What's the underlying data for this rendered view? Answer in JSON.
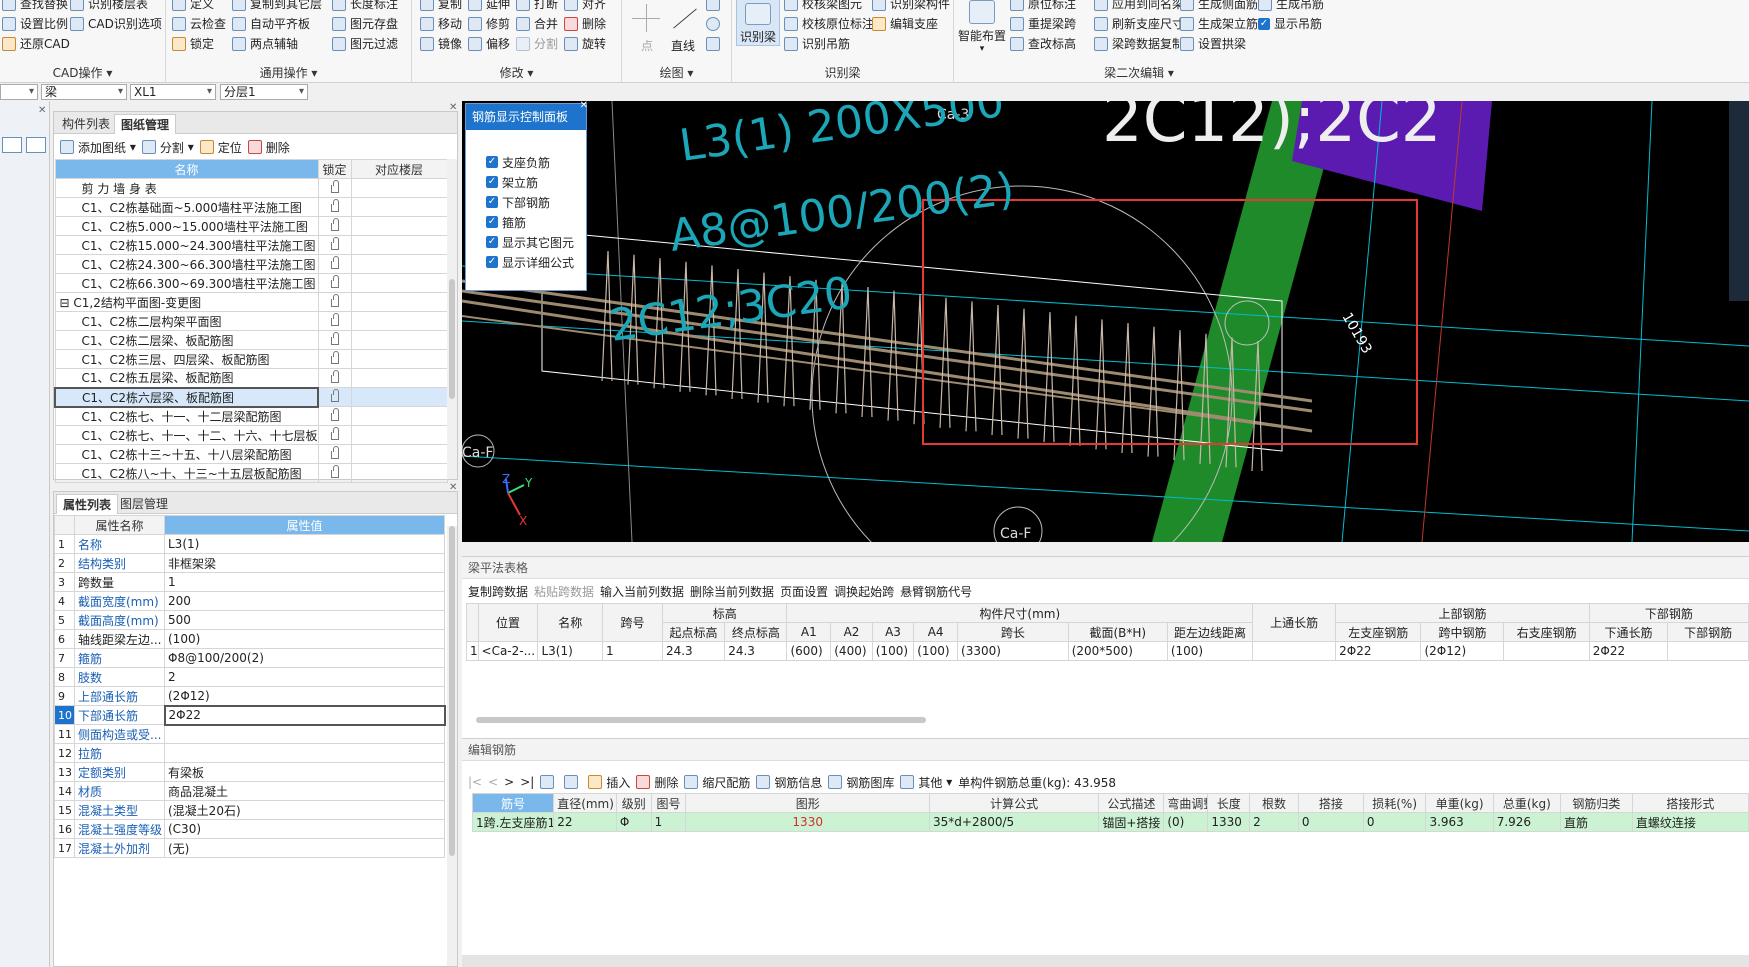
{
  "ribbon": {
    "cad": {
      "items": [
        "查找替换",
        "识别楼层表",
        "设置比例",
        "CAD识别选项",
        "还原CAD"
      ],
      "title": "CAD操作"
    },
    "general": {
      "items": [
        "定义",
        "复制到其它层",
        "长度标注",
        "云检查",
        "自动平齐板",
        "图元存盘",
        "锁定",
        "两点辅轴",
        "图元过滤"
      ],
      "title": "通用操作"
    },
    "modify": {
      "items": [
        "复制",
        "延伸",
        "打断",
        "对齐",
        "移动",
        "修剪",
        "合并",
        "删除",
        "镜像",
        "偏移",
        "分割",
        "旋转"
      ],
      "title": "修改"
    },
    "draw": {
      "items": [
        "点",
        "直线"
      ],
      "title": "绘图"
    },
    "recog": {
      "big": "识别梁",
      "items": [
        "校核梁图元",
        "识别梁构件",
        "校核原位标注",
        "编辑支座",
        "识别吊筋"
      ],
      "title": "识别梁"
    },
    "secondary": {
      "big": "智能布置",
      "items": [
        "原位标注",
        "应用到同名梁",
        "生成侧面筋",
        "生成吊筋",
        "重提梁跨",
        "刷新支座尺寸",
        "生成架立筋",
        "显示吊筋",
        "查改标高",
        "梁跨数据复制",
        "设置拱梁"
      ],
      "title": "梁二次编辑"
    }
  },
  "combos": [
    "梁",
    "XL1",
    "分层1"
  ],
  "drawing_panel": {
    "tabs": [
      "构件列表",
      "图纸管理"
    ],
    "toolbar": [
      "添加图纸",
      "分割",
      "定位",
      "删除"
    ],
    "headers": [
      "名称",
      "锁定",
      "对应楼层"
    ],
    "rows": [
      {
        "name": "剪 力 墙 身 表",
        "indent": 1
      },
      {
        "name": "C1、C2栋基础面~5.000墙柱平法施工图",
        "indent": 1
      },
      {
        "name": "C1、C2栋5.000~15.000墙柱平法施工图",
        "indent": 1
      },
      {
        "name": "C1、C2栋15.000~24.300墙柱平法施工图",
        "indent": 1
      },
      {
        "name": "C1、C2栋24.300~66.300墙柱平法施工图",
        "indent": 1
      },
      {
        "name": "C1、C2栋66.300~69.300墙柱平法施工图",
        "indent": 1
      },
      {
        "name": "C1,2结构平面图-变更图",
        "indent": 0,
        "group": true
      },
      {
        "name": "C1、C2栋二层构架平面图",
        "indent": 1
      },
      {
        "name": "C1、C2栋二层梁、板配筋图",
        "indent": 1
      },
      {
        "name": "C1、C2栋三层、四层梁、板配筋图",
        "indent": 1
      },
      {
        "name": "C1、C2栋五层梁、板配筋图",
        "indent": 1
      },
      {
        "name": "C1、C2栋六层梁、板配筋图",
        "indent": 1,
        "selected": true
      },
      {
        "name": "C1、C2栋七、十一、十二层梁配筋图",
        "indent": 1
      },
      {
        "name": "C1、C2栋七、十一、十二、十六、十七层板配...",
        "indent": 1
      },
      {
        "name": "C1、C2栋十三~十五、十八层梁配筋图",
        "indent": 1
      },
      {
        "name": "C1、C2栋八~十、十三~十五层板配筋图",
        "indent": 1
      }
    ]
  },
  "prop_panel": {
    "tabs": [
      "属性列表",
      "图层管理"
    ],
    "headers": [
      "属性名称",
      "属性值"
    ],
    "rows": [
      {
        "n": "1",
        "k": "名称",
        "v": "L3(1)",
        "blue": true
      },
      {
        "n": "2",
        "k": "结构类别",
        "v": "非框架梁",
        "blue": true
      },
      {
        "n": "3",
        "k": "跨数量",
        "v": "1",
        "blue": false
      },
      {
        "n": "4",
        "k": "截面宽度(mm)",
        "v": "200",
        "blue": true
      },
      {
        "n": "5",
        "k": "截面高度(mm)",
        "v": "500",
        "blue": true
      },
      {
        "n": "6",
        "k": "轴线距梁左边...",
        "v": "(100)",
        "blue": false
      },
      {
        "n": "7",
        "k": "箍筋",
        "v": "Φ8@100/200(2)",
        "blue": true
      },
      {
        "n": "8",
        "k": "肢数",
        "v": "2",
        "blue": true
      },
      {
        "n": "9",
        "k": "上部通长筋",
        "v": "(2Φ12)",
        "blue": true
      },
      {
        "n": "10",
        "k": "下部通长筋",
        "v": "2Φ22",
        "blue": true,
        "active": true
      },
      {
        "n": "11",
        "k": "侧面构造或受...",
        "v": "",
        "blue": true
      },
      {
        "n": "12",
        "k": "拉筋",
        "v": "",
        "blue": true
      },
      {
        "n": "13",
        "k": "定额类别",
        "v": "有梁板",
        "blue": true
      },
      {
        "n": "14",
        "k": "材质",
        "v": "商品混凝土",
        "blue": true
      },
      {
        "n": "15",
        "k": "混凝土类型",
        "v": "(混凝土20石)",
        "blue": true
      },
      {
        "n": "16",
        "k": "混凝土强度等级",
        "v": "(C30)",
        "blue": true
      },
      {
        "n": "17",
        "k": "混凝土外加剂",
        "v": "(无)",
        "blue": true
      }
    ]
  },
  "control_panel": {
    "title": "钢筋显示控制面板",
    "items": [
      "支座负筋",
      "架立筋",
      "下部钢筋",
      "箍筋",
      "显示其它图元",
      "显示详细公式"
    ]
  },
  "canvas": {
    "labels": {
      "ca3": "Ca-3",
      "caf1": "Ca-F",
      "caf2": "Ca-F",
      "dim": "10193",
      "big_text": "2C12);2C2",
      "left_text": "L3(1) 200X500",
      "stirrup_text": "A8@100/200(2)",
      "bottom_text": "2C12;3C20",
      "axis_x": "X",
      "axis_y": "Y",
      "axis_z": "Z"
    }
  },
  "beam_table": {
    "title": "梁平法表格",
    "toolbar": [
      "复制跨数据",
      "粘贴跨数据",
      "输入当前列数据",
      "删除当前列数据",
      "页面设置",
      "调换起始跨",
      "悬臂钢筋代号"
    ],
    "head1": [
      "位置",
      "名称",
      "跨号",
      "标高",
      "构件尺寸(mm)",
      "上通长筋",
      "上部钢筋",
      "下部钢筋"
    ],
    "head2": [
      "起点标高",
      "终点标高",
      "A1",
      "A2",
      "A3",
      "A4",
      "跨长",
      "截面(B*H)",
      "距左边线距离",
      "左支座钢筋",
      "跨中钢筋",
      "右支座钢筋",
      "下通长筋",
      "下部钢筋"
    ],
    "row": [
      "1",
      "<Ca-2-...",
      "L3(1)",
      "1",
      "24.3",
      "24.3",
      "(600)",
      "(400)",
      "(100)",
      "(100)",
      "(3300)",
      "(200*500)",
      "(100)",
      "",
      "2Φ22",
      "(2Φ12)",
      "",
      "2Φ22",
      ""
    ]
  },
  "rebar_table": {
    "title": "编辑钢筋",
    "toolbar": [
      "插入",
      "删除",
      "缩尺配筋",
      "钢筋信息",
      "钢筋图库",
      "其他"
    ],
    "total": "单构件钢筋总重(kg): 43.958",
    "headers": [
      "筋号",
      "直径(mm)",
      "级别",
      "图号",
      "图形",
      "计算公式",
      "公式描述",
      "弯曲调整",
      "长度",
      "根数",
      "搭接",
      "损耗(%)",
      "单重(kg)",
      "总重(kg)",
      "钢筋归类",
      "搭接形式"
    ],
    "row": [
      "1跨.左支座筋1",
      "22",
      "Φ",
      "1",
      "1330",
      "35*d+2800/5",
      "锚固+搭接",
      "(0)",
      "1330",
      "2",
      "0",
      "0",
      "3.963",
      "7.926",
      "直筋",
      "直螺纹连接"
    ]
  }
}
